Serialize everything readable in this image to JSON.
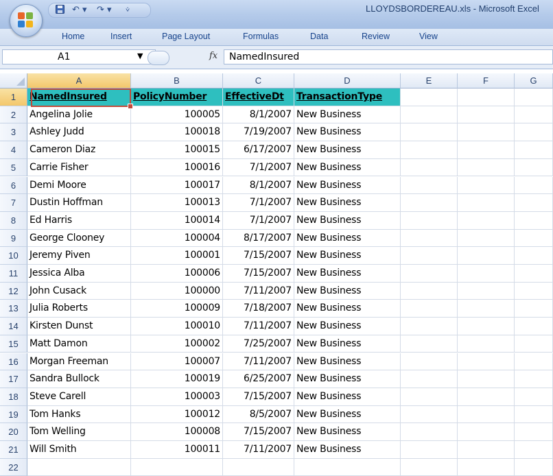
{
  "window": {
    "title": "LLOYDSBORDEREAU.xls - Microsoft Excel",
    "qat": {
      "save_icon": "save-icon",
      "undo": "↶ ▾",
      "redo": "↷ ▾",
      "customize": "⩒"
    }
  },
  "ribbon": {
    "tabs": [
      "Home",
      "Insert",
      "Page Layout",
      "Formulas",
      "Data",
      "Review",
      "View"
    ]
  },
  "formula_bar": {
    "name_box": "A1",
    "fx_label": "fx",
    "value": "NamedInsured"
  },
  "grid": {
    "columns": [
      "A",
      "B",
      "C",
      "D",
      "E",
      "F",
      "G"
    ],
    "rows": [
      "1",
      "2",
      "3",
      "4",
      "5",
      "6",
      "7",
      "8",
      "9",
      "10",
      "11",
      "12",
      "13",
      "14",
      "15",
      "16",
      "17",
      "18",
      "19",
      "20",
      "21",
      "22"
    ],
    "header": [
      "NamedInsured",
      "PolicyNumber",
      "EffectiveDt",
      "TransactionType"
    ],
    "data": [
      [
        "Angelina Jolie",
        "100005",
        "8/1/2007",
        "New Business"
      ],
      [
        "Ashley Judd",
        "100018",
        "7/19/2007",
        "New Business"
      ],
      [
        "Cameron Diaz",
        "100015",
        "6/17/2007",
        "New Business"
      ],
      [
        "Carrie Fisher",
        "100016",
        "7/1/2007",
        "New Business"
      ],
      [
        "Demi Moore",
        "100017",
        "8/1/2007",
        "New Business"
      ],
      [
        "Dustin Hoffman",
        "100013",
        "7/1/2007",
        "New Business"
      ],
      [
        "Ed Harris",
        "100014",
        "7/1/2007",
        "New Business"
      ],
      [
        "George Clooney",
        "100004",
        "8/17/2007",
        "New Business"
      ],
      [
        "Jeremy Piven",
        "100001",
        "7/15/2007",
        "New Business"
      ],
      [
        "Jessica Alba",
        "100006",
        "7/15/2007",
        "New Business"
      ],
      [
        "John Cusack",
        "100000",
        "7/11/2007",
        "New Business"
      ],
      [
        "Julia Roberts",
        "100009",
        "7/18/2007",
        "New Business"
      ],
      [
        "Kirsten Dunst",
        "100010",
        "7/11/2007",
        "New Business"
      ],
      [
        "Matt Damon",
        "100002",
        "7/25/2007",
        "New Business"
      ],
      [
        "Morgan Freeman",
        "100007",
        "7/11/2007",
        "New Business"
      ],
      [
        "Sandra Bullock",
        "100019",
        "6/25/2007",
        "New Business"
      ],
      [
        "Steve Carell",
        "100003",
        "7/15/2007",
        "New Business"
      ],
      [
        "Tom Hanks",
        "100012",
        "8/5/2007",
        "New Business"
      ],
      [
        "Tom Welling",
        "100008",
        "7/15/2007",
        "New Business"
      ],
      [
        "Will Smith",
        "100011",
        "7/11/2007",
        "New Business"
      ]
    ],
    "colors": {
      "header_fill": "#2ebfbf",
      "active_border": "#c24a3a"
    }
  }
}
